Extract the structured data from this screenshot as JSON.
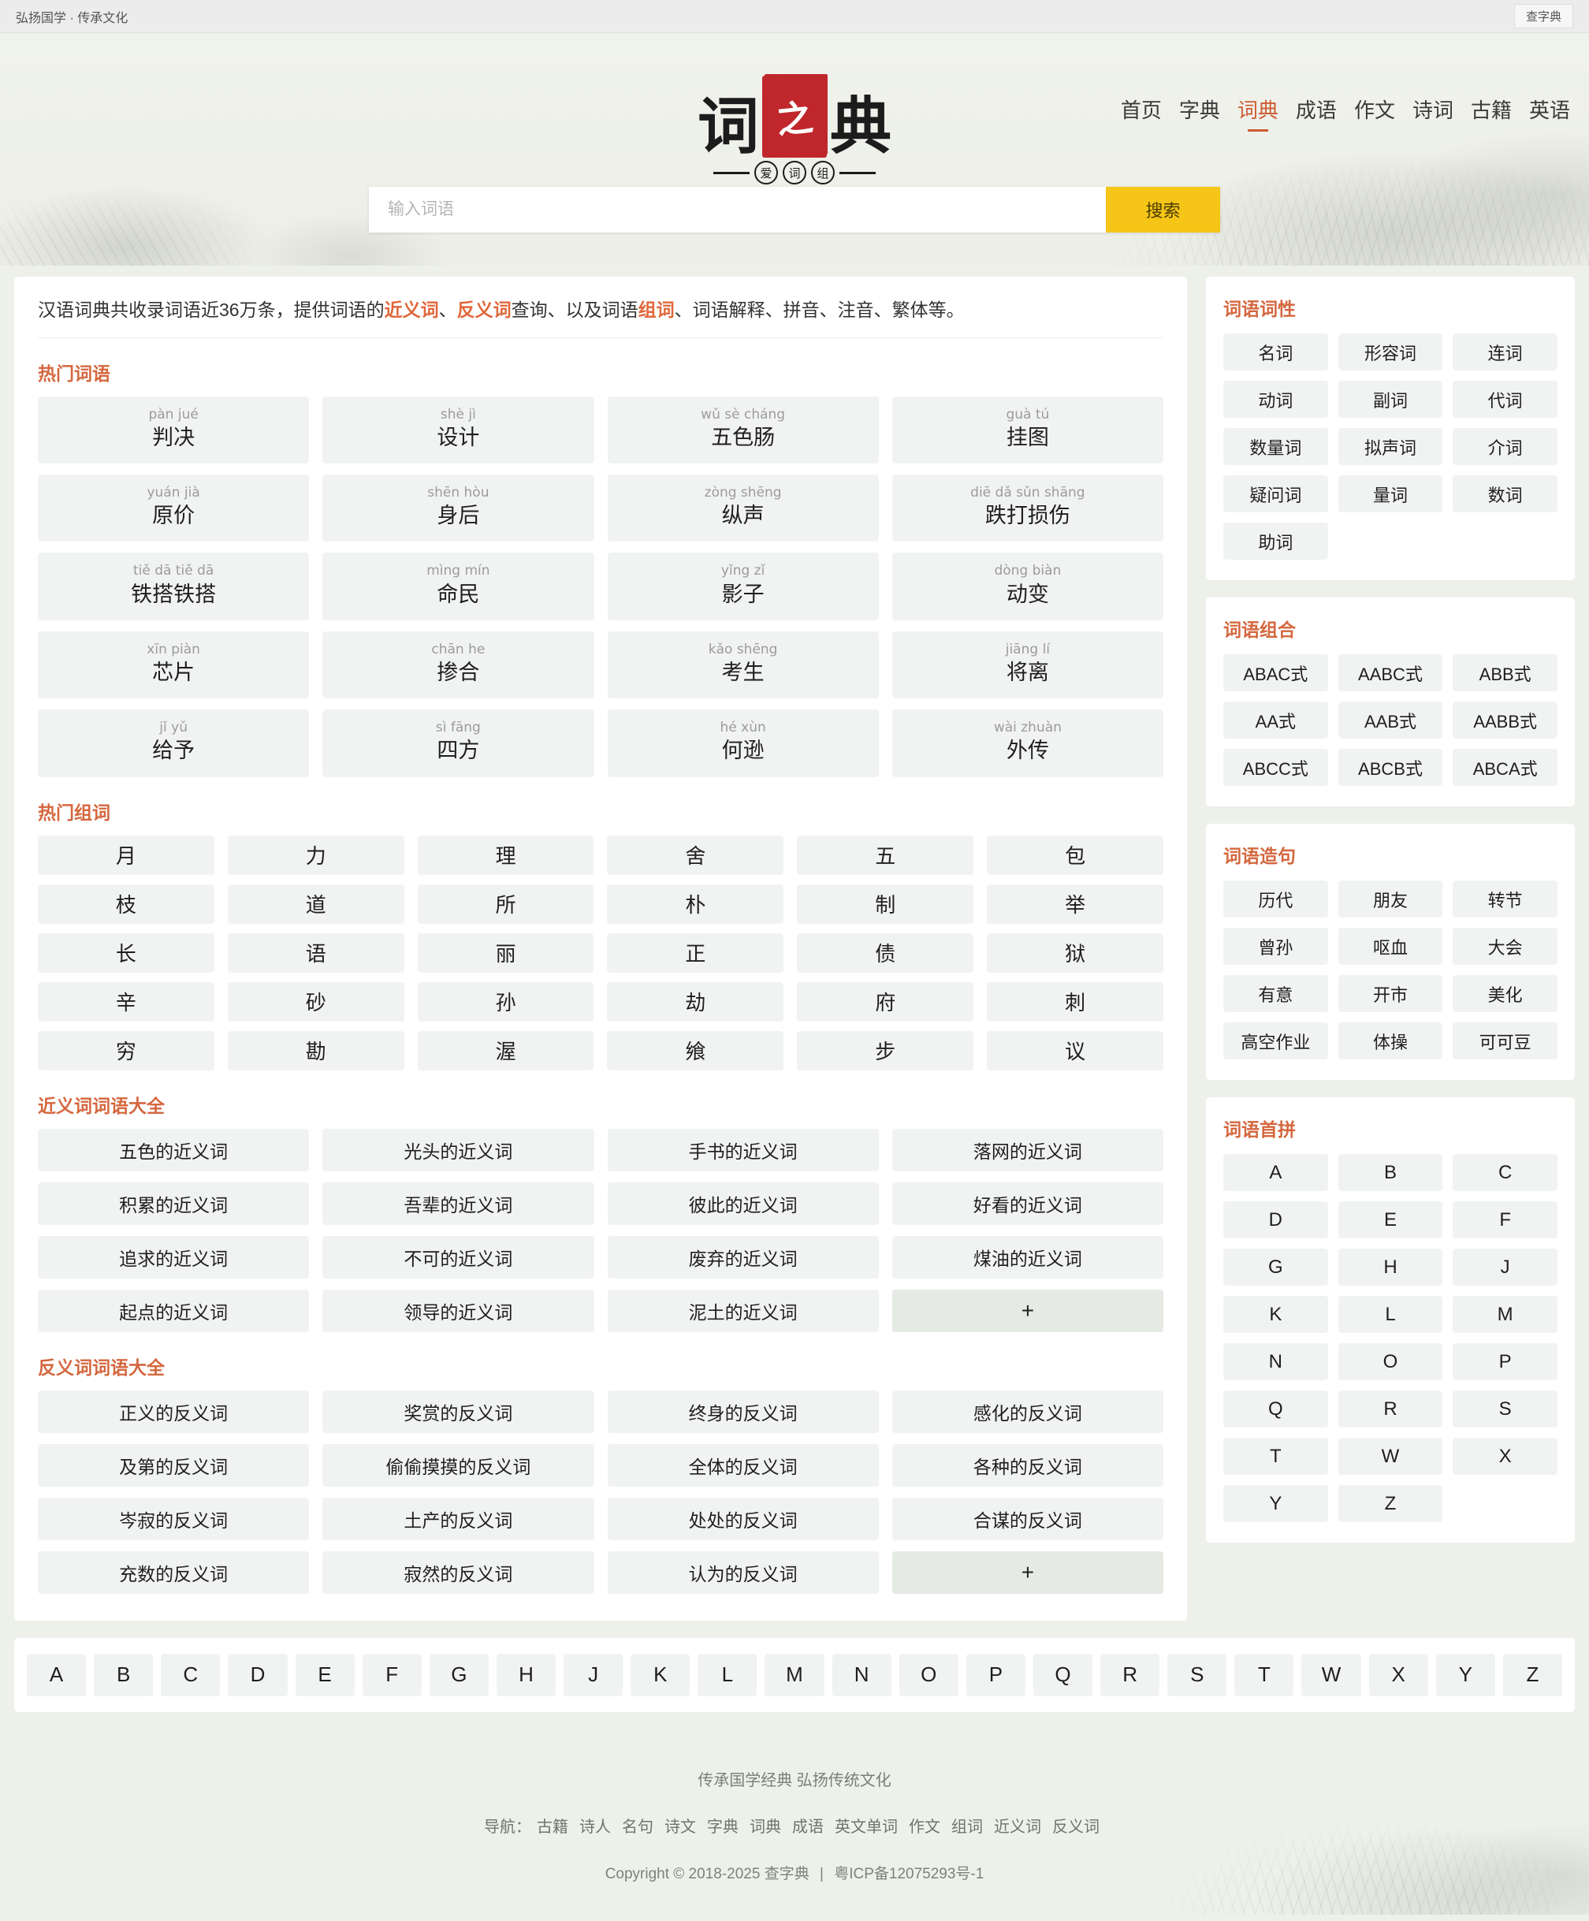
{
  "topbar": {
    "slogan": "弘扬国学 · 传承文化",
    "right_button": "查字典"
  },
  "nav": [
    {
      "label": "首页",
      "active": false
    },
    {
      "label": "字典",
      "active": false
    },
    {
      "label": "词典",
      "active": true
    },
    {
      "label": "成语",
      "active": false
    },
    {
      "label": "作文",
      "active": false
    },
    {
      "label": "诗词",
      "active": false
    },
    {
      "label": "古籍",
      "active": false
    },
    {
      "label": "英语",
      "active": false
    }
  ],
  "logo": {
    "char1": "词",
    "seal": "之",
    "char2": "典",
    "sub": [
      "爱",
      "词",
      "组"
    ]
  },
  "search": {
    "placeholder": "输入词语",
    "button": "搜索",
    "value": ""
  },
  "intro": {
    "p1": "汉语词典共收录词语近36万条，提供词语的",
    "hl1": "近义词",
    "p2": "、",
    "hl2": "反义词",
    "p3": "查询、以及词语",
    "hl3": "组词",
    "p4": "、词语解释、拼音、注音、繁体等。"
  },
  "sections": {
    "hot_words_title": "热门词语",
    "hot_chars_title": "热门组词",
    "synonyms_title": "近义词词语大全",
    "antonyms_title": "反义词词语大全"
  },
  "hot_words": [
    {
      "pinyin": "pàn jué",
      "word": "判决"
    },
    {
      "pinyin": "shè jì",
      "word": "设计"
    },
    {
      "pinyin": "wǔ sè cháng",
      "word": "五色肠"
    },
    {
      "pinyin": "guà tú",
      "word": "挂图"
    },
    {
      "pinyin": "yuán jià",
      "word": "原价"
    },
    {
      "pinyin": "shēn hòu",
      "word": "身后"
    },
    {
      "pinyin": "zòng shēng",
      "word": "纵声"
    },
    {
      "pinyin": "diē dǎ sǔn shāng",
      "word": "跌打损伤"
    },
    {
      "pinyin": "tiě dā tiě dā",
      "word": "铁搭铁搭"
    },
    {
      "pinyin": "mìng mín",
      "word": "命民"
    },
    {
      "pinyin": "yǐng zǐ",
      "word": "影子"
    },
    {
      "pinyin": "dòng biàn",
      "word": "动变"
    },
    {
      "pinyin": "xīn piàn",
      "word": "芯片"
    },
    {
      "pinyin": "chān he",
      "word": "掺合"
    },
    {
      "pinyin": "kǎo shēng",
      "word": "考生"
    },
    {
      "pinyin": "jiāng lí",
      "word": "将离"
    },
    {
      "pinyin": "jǐ yǔ",
      "word": "给予"
    },
    {
      "pinyin": "sì fāng",
      "word": "四方"
    },
    {
      "pinyin": "hé xùn",
      "word": "何逊"
    },
    {
      "pinyin": "wài zhuàn",
      "word": "外传"
    }
  ],
  "hot_chars": [
    "月",
    "力",
    "理",
    "舍",
    "五",
    "包",
    "枝",
    "道",
    "所",
    "朴",
    "制",
    "举",
    "长",
    "语",
    "丽",
    "正",
    "债",
    "狱",
    "辛",
    "砂",
    "孙",
    "劫",
    "府",
    "刺",
    "穷",
    "勘",
    "渥",
    "飨",
    "步",
    "议"
  ],
  "synonyms": [
    "五色的近义词",
    "光头的近义词",
    "手书的近义词",
    "落网的近义词",
    "积累的近义词",
    "吾辈的近义词",
    "彼此的近义词",
    "好看的近义词",
    "追求的近义词",
    "不可的近义词",
    "废弃的近义词",
    "煤油的近义词",
    "起点的近义词",
    "领导的近义词",
    "泥土的近义词",
    "+"
  ],
  "antonyms": [
    "正义的反义词",
    "奖赏的反义词",
    "终身的反义词",
    "感化的反义词",
    "及第的反义词",
    "偷偷摸摸的反义词",
    "全体的反义词",
    "各种的反义词",
    "岑寂的反义词",
    "土产的反义词",
    "处处的反义词",
    "合谋的反义词",
    "充数的反义词",
    "寂然的反义词",
    "认为的反义词",
    "+"
  ],
  "sidebar": {
    "pos": {
      "title": "词语词性",
      "items": [
        "名词",
        "形容词",
        "连词",
        "动词",
        "副词",
        "代词",
        "数量词",
        "拟声词",
        "介词",
        "疑问词",
        "量词",
        "数词",
        "助词"
      ]
    },
    "combo": {
      "title": "词语组合",
      "items": [
        "ABAC式",
        "AABC式",
        "ABB式",
        "AA式",
        "AAB式",
        "AABB式",
        "ABCC式",
        "ABCB式",
        "ABCA式"
      ]
    },
    "sentence": {
      "title": "词语造句",
      "items": [
        "历代",
        "朋友",
        "转节",
        "曾孙",
        "呕血",
        "大会",
        "有意",
        "开市",
        "美化",
        "高空作业",
        "体操",
        "可可豆"
      ]
    },
    "initials": {
      "title": "词语首拼",
      "items": [
        "A",
        "B",
        "C",
        "D",
        "E",
        "F",
        "G",
        "H",
        "J",
        "K",
        "L",
        "M",
        "N",
        "O",
        "P",
        "Q",
        "R",
        "S",
        "T",
        "W",
        "X",
        "Y",
        "Z"
      ]
    }
  },
  "alphabet_bar": [
    "A",
    "B",
    "C",
    "D",
    "E",
    "F",
    "G",
    "H",
    "J",
    "K",
    "L",
    "M",
    "N",
    "O",
    "P",
    "Q",
    "R",
    "S",
    "T",
    "W",
    "X",
    "Y",
    "Z"
  ],
  "footer": {
    "slogan": "传承国学经典 弘扬传统文化",
    "nav_label": "导航：",
    "nav_items": [
      "古籍",
      "诗人",
      "名句",
      "诗文",
      "字典",
      "词典",
      "成语",
      "英文单词",
      "作文",
      "组词",
      "近义词",
      "反义词"
    ],
    "copyright": "Copyright © 2018-2025 查字典",
    "separator": "|",
    "icp": "粤ICP备12075293号-1"
  },
  "colors": {
    "accent": "#cc5c33",
    "seal": "#c0272d",
    "search_button": "#f5c518",
    "page_bg": "#eef1ea"
  }
}
